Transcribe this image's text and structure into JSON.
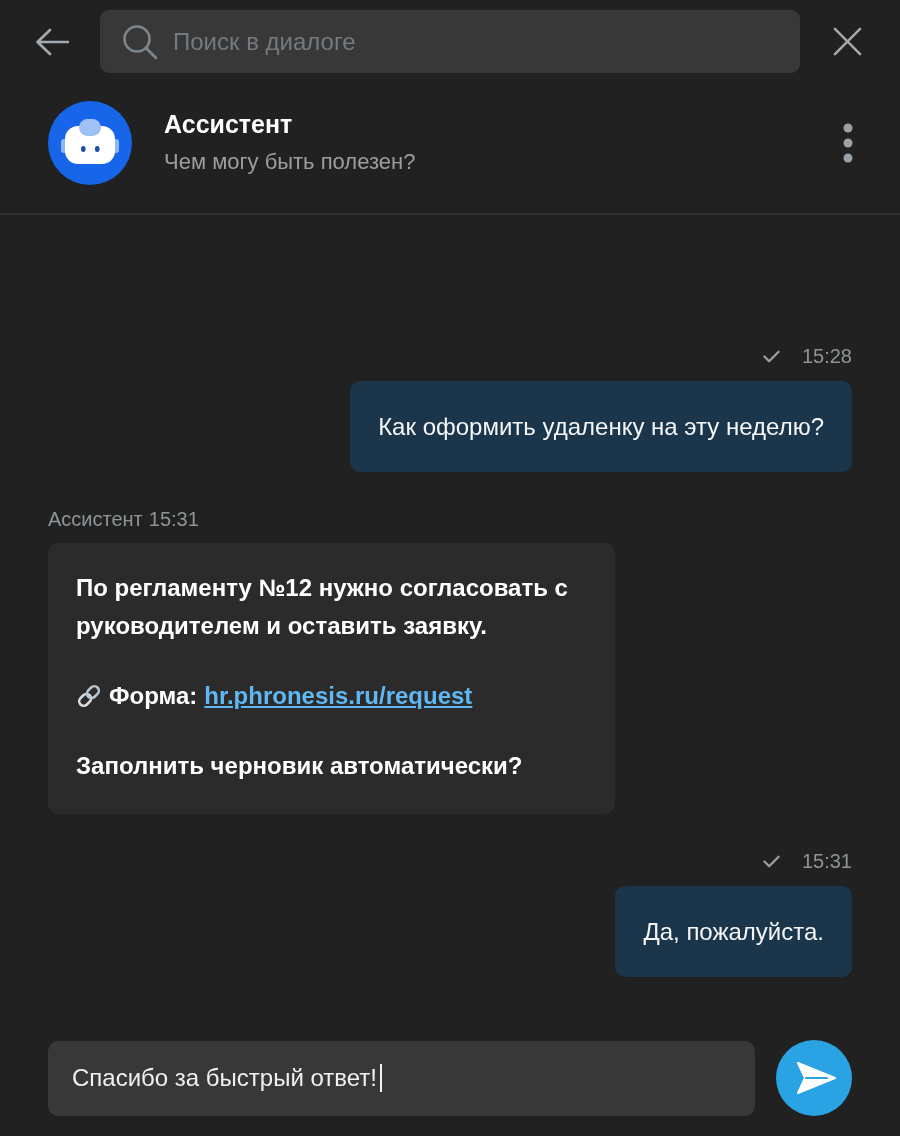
{
  "top_bar": {
    "search": {
      "placeholder": "Поиск в диалоге"
    }
  },
  "chat_header": {
    "name": "Ассистент",
    "subtitle": "Чем могу быть полезен?"
  },
  "messages": [
    {
      "kind": "outgoing",
      "sent": true,
      "time": "15:28",
      "text": "Как оформить удаленку на эту неделю?"
    },
    {
      "kind": "incoming",
      "sender": "Ассистент",
      "time": "15:31",
      "paragraphs": [
        {
          "kind": "text",
          "text": "По регламенту №12 нужно согласовать с руководителем и оставить заявку."
        },
        {
          "kind": "link",
          "label": "Форма:",
          "url": "hr.phronesis.ru/request"
        },
        {
          "kind": "text",
          "text": "Заполнить черновик автоматически?"
        }
      ]
    },
    {
      "kind": "outgoing",
      "sent": true,
      "time": "15:31",
      "text": "Да, пожалуйста."
    }
  ],
  "composer": {
    "value": "Спасибо за быстрый ответ!",
    "focused": true
  }
}
